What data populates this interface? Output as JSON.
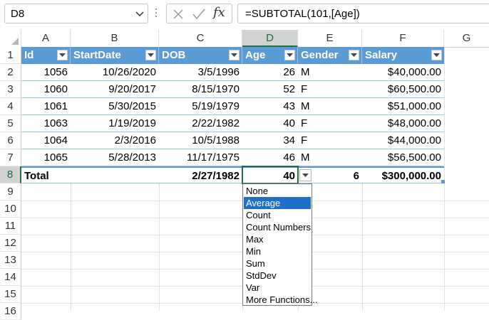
{
  "formula_bar": {
    "name_box": "D8",
    "formula": "=SUBTOTAL(101,[Age])",
    "fx_label": "fx"
  },
  "columns": [
    "A",
    "B",
    "C",
    "D",
    "E",
    "F",
    "G"
  ],
  "rows": [
    "1",
    "2",
    "3",
    "4",
    "5",
    "6",
    "7",
    "8",
    "9",
    "10",
    "11",
    "12",
    "13",
    "14",
    "15",
    "16"
  ],
  "table": {
    "headers": [
      "Id",
      "StartDate",
      "DOB",
      "Age",
      "Gender",
      "Salary"
    ],
    "data": [
      [
        "1056",
        "10/26/2020",
        "3/5/1996",
        "26",
        "M",
        "$40,000.00"
      ],
      [
        "1060",
        "9/20/2017",
        "8/15/1970",
        "52",
        "F",
        "$60,500.00"
      ],
      [
        "1061",
        "5/30/2015",
        "5/19/1979",
        "43",
        "M",
        "$51,000.00"
      ],
      [
        "1063",
        "1/19/2019",
        "2/22/1982",
        "40",
        "F",
        "$48,000.00"
      ],
      [
        "1064",
        "2/3/2016",
        "10/5/1988",
        "34",
        "F",
        "$44,000.00"
      ],
      [
        "1065",
        "5/28/2013",
        "11/17/1975",
        "46",
        "M",
        "$56,500.00"
      ]
    ],
    "total": [
      "Total",
      "",
      "2/27/1982",
      "40",
      "6",
      "$300,000.00"
    ]
  },
  "total_dropdown": {
    "options": [
      "None",
      "Average",
      "Count",
      "Count Numbers",
      "Max",
      "Min",
      "Sum",
      "StdDev",
      "Var",
      "More Functions..."
    ],
    "highlighted": "Average"
  },
  "colors": {
    "table_header": "#5b9bd5",
    "selection": "#217346",
    "highlight": "#1f6fc9"
  }
}
